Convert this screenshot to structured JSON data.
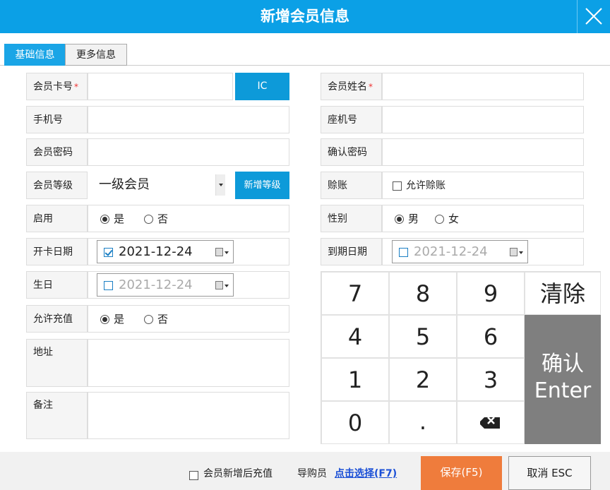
{
  "window": {
    "title": "新增会员信息"
  },
  "tabs": [
    {
      "label": "基础信息",
      "active": true
    },
    {
      "label": "更多信息",
      "active": false
    }
  ],
  "left_form": {
    "card_no": {
      "label": "会员卡号",
      "required": "*",
      "value": "",
      "button": "IC"
    },
    "mobile": {
      "label": "手机号",
      "value": ""
    },
    "password": {
      "label": "会员密码",
      "value": ""
    },
    "level": {
      "label": "会员等级",
      "selected": "一级会员",
      "button": "新增等级"
    },
    "enabled": {
      "label": "启用",
      "options": [
        "是",
        "否"
      ],
      "selected": "是"
    },
    "open_date": {
      "label": "开卡日期",
      "value": "2021-12-24",
      "checked": true
    },
    "birthday": {
      "label": "生日",
      "value": "2021-12-24",
      "checked": false
    },
    "allow_recharge": {
      "label": "允许充值",
      "options": [
        "是",
        "否"
      ],
      "selected": "是"
    },
    "address": {
      "label": "地址",
      "value": ""
    },
    "remark": {
      "label": "备注",
      "value": ""
    }
  },
  "right_form": {
    "name": {
      "label": "会员姓名",
      "required": "*",
      "value": ""
    },
    "landline": {
      "label": "座机号",
      "value": ""
    },
    "confirm_password": {
      "label": "确认密码",
      "value": ""
    },
    "credit": {
      "label": "赊账",
      "checkbox_label": "允许赊账",
      "checked": false
    },
    "gender": {
      "label": "性别",
      "options": [
        "男",
        "女"
      ],
      "selected": "男"
    },
    "expire_date": {
      "label": "到期日期",
      "value": "2021-12-24",
      "checked": false
    }
  },
  "keypad": {
    "digits": [
      "7",
      "8",
      "9",
      "4",
      "5",
      "6",
      "1",
      "2",
      "3",
      "0",
      "."
    ],
    "clear": "清除",
    "confirm_line1": "确认",
    "confirm_line2": "Enter",
    "backspace_icon": "backspace-icon"
  },
  "footer": {
    "recharge_after_add": "会员新增后充值",
    "guide_label": "导购员",
    "guide_link": "点击选择(F7)",
    "save": "保存(F5)",
    "cancel": "取消 ESC"
  },
  "colors": {
    "titlebar": "#0ba0e6",
    "accent_blue": "#0d9ad9",
    "save": "#ef7c3c",
    "confirm_key": "#7f7f7f"
  }
}
